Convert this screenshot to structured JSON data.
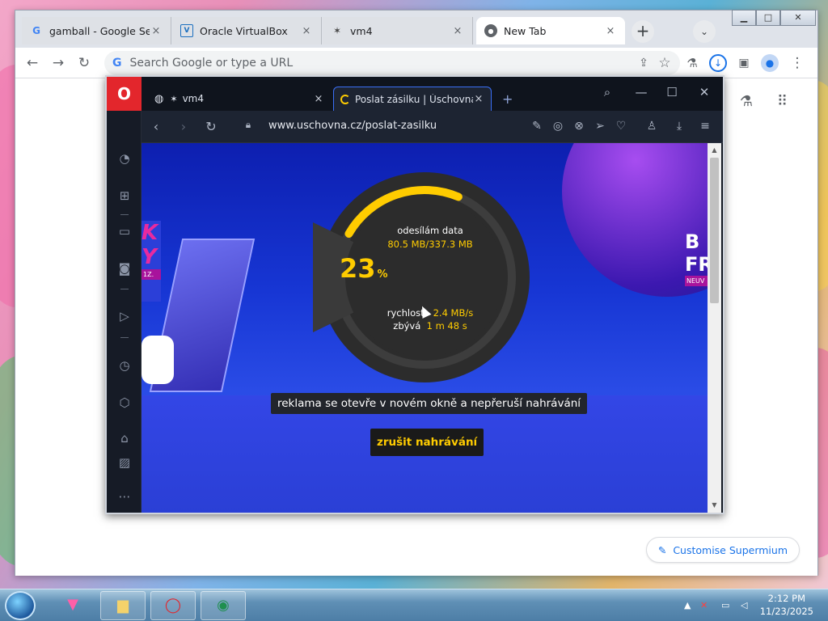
{
  "chrome": {
    "tabs": [
      {
        "favicon": "google-icon",
        "title": "gamball - Google Sea",
        "close": "×"
      },
      {
        "favicon": "virtualbox-icon",
        "title": "Oracle VirtualBox",
        "close": "×"
      },
      {
        "favicon": "vm-icon",
        "title": "vm4",
        "close": "×"
      },
      {
        "favicon": "chrome-icon",
        "title": "New Tab",
        "close": "×"
      }
    ],
    "new_tab_label": "+",
    "window_controls": {
      "minimize": "▁",
      "maximize": "□",
      "close": "✕"
    },
    "omnibox_placeholder": "Search Google or type a URL",
    "customise_label": "Customise Supermium"
  },
  "opera": {
    "tabs": [
      {
        "title": "vm4",
        "close": "×"
      },
      {
        "title": "Poslat zásilku | Úschovna.cz",
        "close": "×"
      }
    ],
    "new_tab_label": "+",
    "url": "www.uschovna.cz/poslat-zasilku"
  },
  "upload": {
    "status_label": "odesílám data",
    "transferred": "80.5 MB/337.3 MB",
    "percent": "23",
    "percent_sign": "%",
    "progress_fraction": 0.23,
    "speed_label": "rychlost",
    "speed_value": "2.4 MB/s",
    "remaining_label": "zbývá",
    "remaining_value": "1 m 48 s",
    "notice": "reklama se otevře v novém okně a nepřeruší nahrávání",
    "cancel_label": "zrušit nahrávání"
  },
  "ad": {
    "left_text": "K\nY",
    "left_date": "1Z.",
    "right_text": "B\nFR",
    "right_badge": "NEUV"
  },
  "taskbar": {
    "clock_time": "2:12 PM",
    "clock_date": "11/23/2025"
  }
}
